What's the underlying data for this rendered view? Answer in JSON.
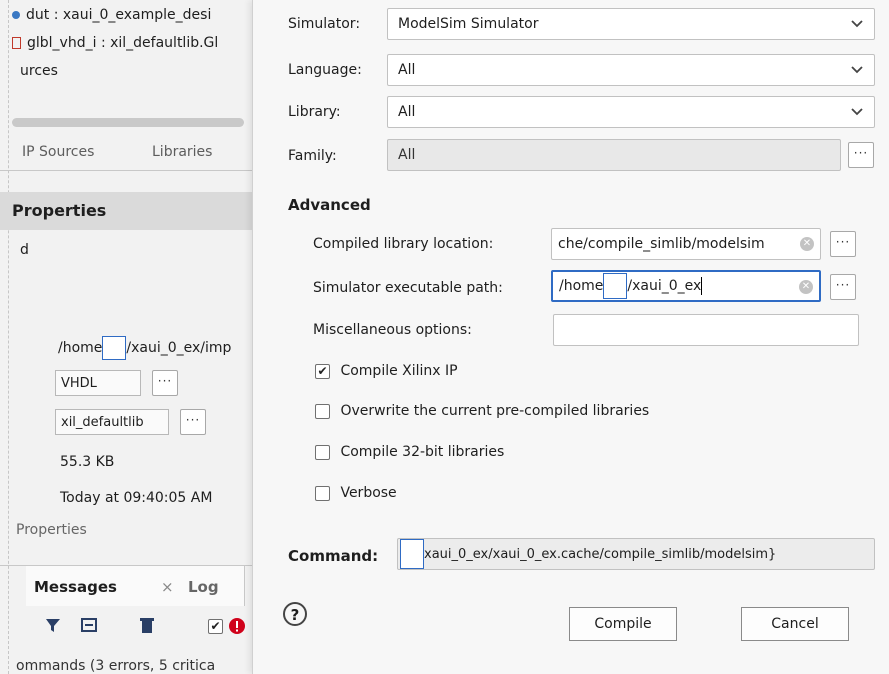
{
  "left_pane": {
    "tree": [
      {
        "text": "dut : xaui_0_example_desi",
        "icon": "module-dot-icon"
      },
      {
        "text": "glbl_vhd_i : xil_defaultlib.Gl",
        "icon": "vhdl-file-icon"
      },
      {
        "text": "urces",
        "icon": ""
      }
    ],
    "tabs": [
      "IP Sources",
      "Libraries"
    ],
    "properties_header": "Properties",
    "name_row": "d",
    "path_prefix": "/home",
    "path_suffix": "/xaui_0_ex/imp",
    "file_type": "VHDL",
    "library": "xil_defaultlib",
    "size": "55.3 KB",
    "modified": "Today at 09:40:05 AM",
    "properties_tab": "Properties",
    "messages_tab": "Messages",
    "messages_close": "×",
    "log_tab": "Log",
    "status_text": "ommands (3 errors, 5 critica",
    "more_label": "···"
  },
  "dialog": {
    "simulator_label": "Simulator:",
    "simulator_value": "ModelSim Simulator",
    "language_label": "Language:",
    "language_value": "All",
    "library_label": "Library:",
    "library_value": "All",
    "family_label": "Family:",
    "family_value": "All",
    "advanced_header": "Advanced",
    "compiled_location_label": "Compiled library location:",
    "compiled_location_value": "che/compile_simlib/modelsim",
    "exec_path_label": "Simulator executable path:",
    "exec_path_prefix": "/home",
    "exec_path_suffix": "/xaui_0_ex",
    "misc_label": "Miscellaneous options:",
    "misc_value": "",
    "options": [
      {
        "label": "Compile Xilinx IP",
        "checked": true
      },
      {
        "label": "Overwrite the current pre-compiled libraries",
        "checked": false
      },
      {
        "label": "Compile 32-bit libraries",
        "checked": false
      },
      {
        "label": "Verbose",
        "checked": false
      }
    ],
    "command_label": "Command:",
    "command_value": "xaui_0_ex/xaui_0_ex.cache/compile_simlib/modelsim}",
    "help_label": "?",
    "compile_button": "Compile",
    "cancel_button": "Cancel",
    "more_label": "···",
    "check_mark": "✔",
    "clear_mark": "✕"
  },
  "colors": {
    "accent": "#2f6bc4",
    "error": "#d0021b"
  }
}
